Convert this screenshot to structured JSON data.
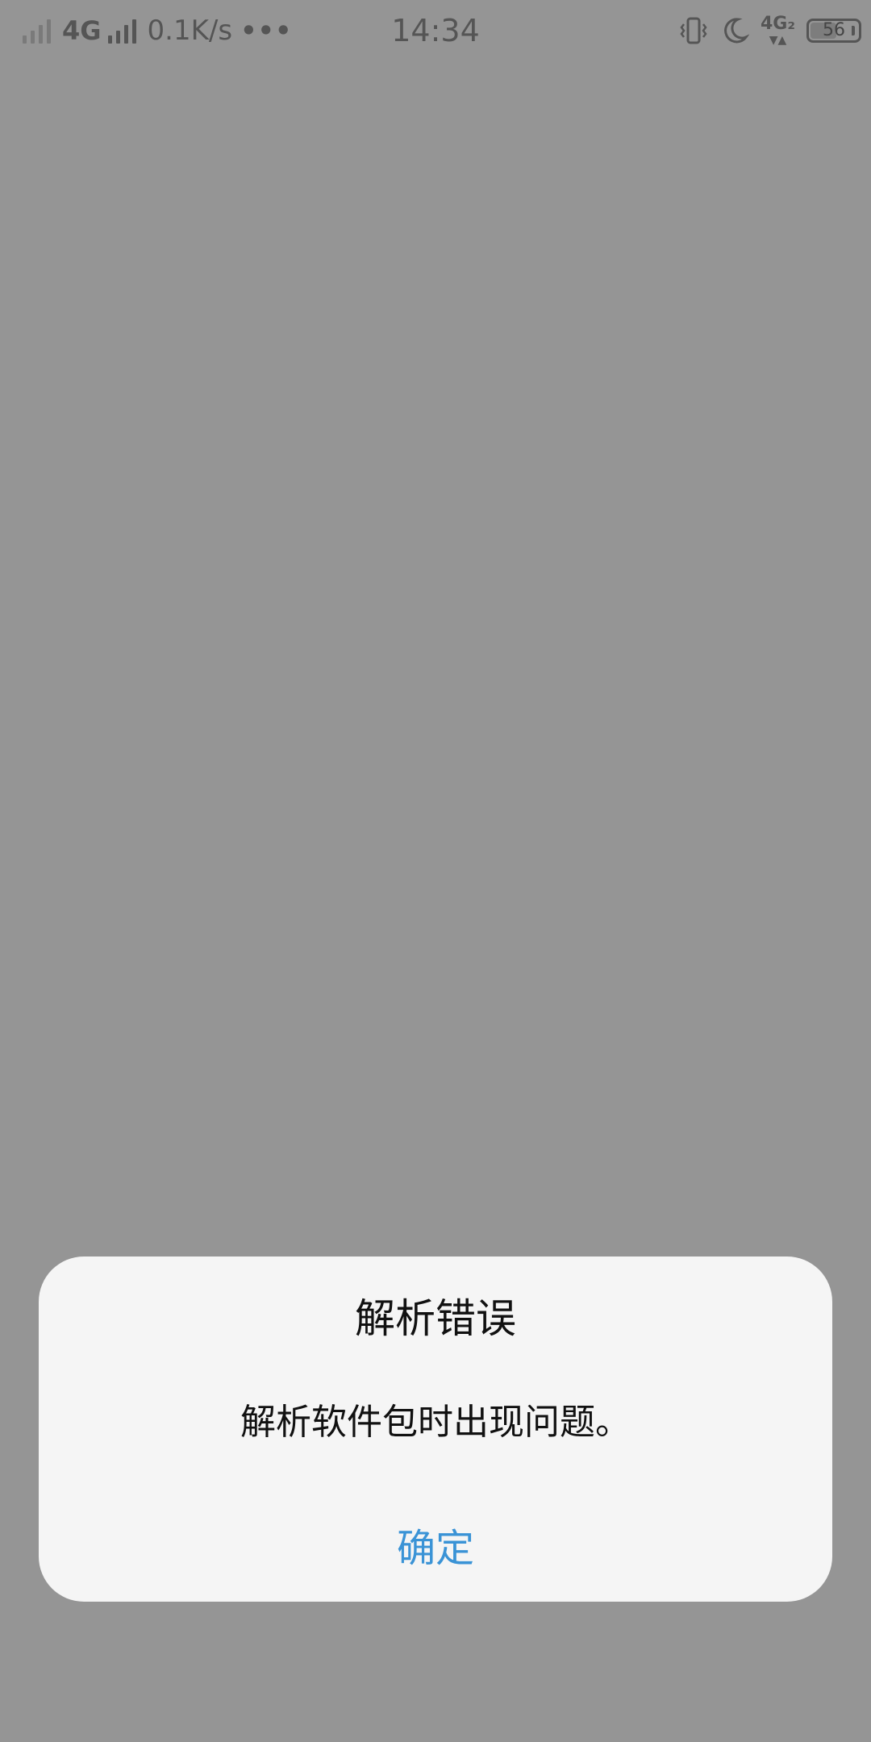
{
  "status_bar": {
    "network_label": "4G",
    "speed": "0.1K/s",
    "more": "•••",
    "time": "14:34",
    "secondary_network": "4G₂",
    "battery_level": "56",
    "battery_fraction": 0.56,
    "icons": [
      "signal-icon-1",
      "signal-icon-2",
      "vibrate-icon",
      "do-not-disturb-moon-icon",
      "data-arrows-icon",
      "battery-icon"
    ]
  },
  "dialog": {
    "title": "解析错误",
    "message": "解析软件包时出现问题。",
    "confirm_label": "确定"
  },
  "colors": {
    "overlay_background": "#959595",
    "dialog_background": "#f5f5f5",
    "accent": "#3a93d6",
    "status_text": "#555555"
  }
}
